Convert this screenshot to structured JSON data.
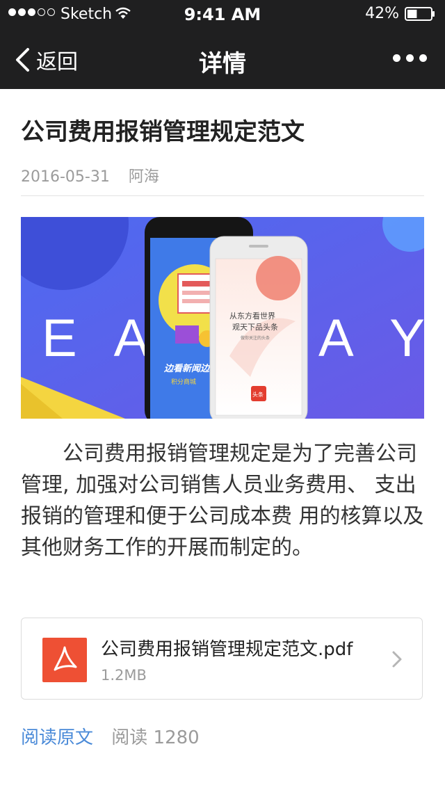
{
  "status_bar": {
    "carrier": "Sketch",
    "time": "9:41 AM",
    "battery": "42%",
    "battery_level": 0.42,
    "signal_bars": 3
  },
  "nav": {
    "back_label": "返回",
    "title": "详情",
    "more_icon": "more-horizontal-icon"
  },
  "article": {
    "title": "公司费用报销管理规定范文",
    "date": "2016-05-31",
    "author": "阿海",
    "body": "公司费用报销管理规定是为了完善公司管理, 加强对公司销售人员业务费用、 支出报销的管理和便于公司成本费 用的核算以及其他财务工作的开展而制定的。"
  },
  "banner": {
    "left_text": "E A",
    "right_text": "A Y",
    "screen_line1": "从东方看世界",
    "screen_line2": "观天下品头条",
    "screen_caption": "做你关注的头条",
    "app_badge": "头条",
    "phone_caption": "边看新闻边",
    "phone_caption2": "积分商城"
  },
  "attachment": {
    "file_name": "公司费用报销管理规定范文.pdf",
    "file_size": "1.2MB",
    "icon": "pdf-icon"
  },
  "footer": {
    "read_original": "阅读原文",
    "read_count": "阅读 1280"
  },
  "colors": {
    "nav_bg": "#1f1f20",
    "link": "#4a8ad8",
    "pdf_red": "#ee5034",
    "banner_blue": "#5b6ee8"
  }
}
